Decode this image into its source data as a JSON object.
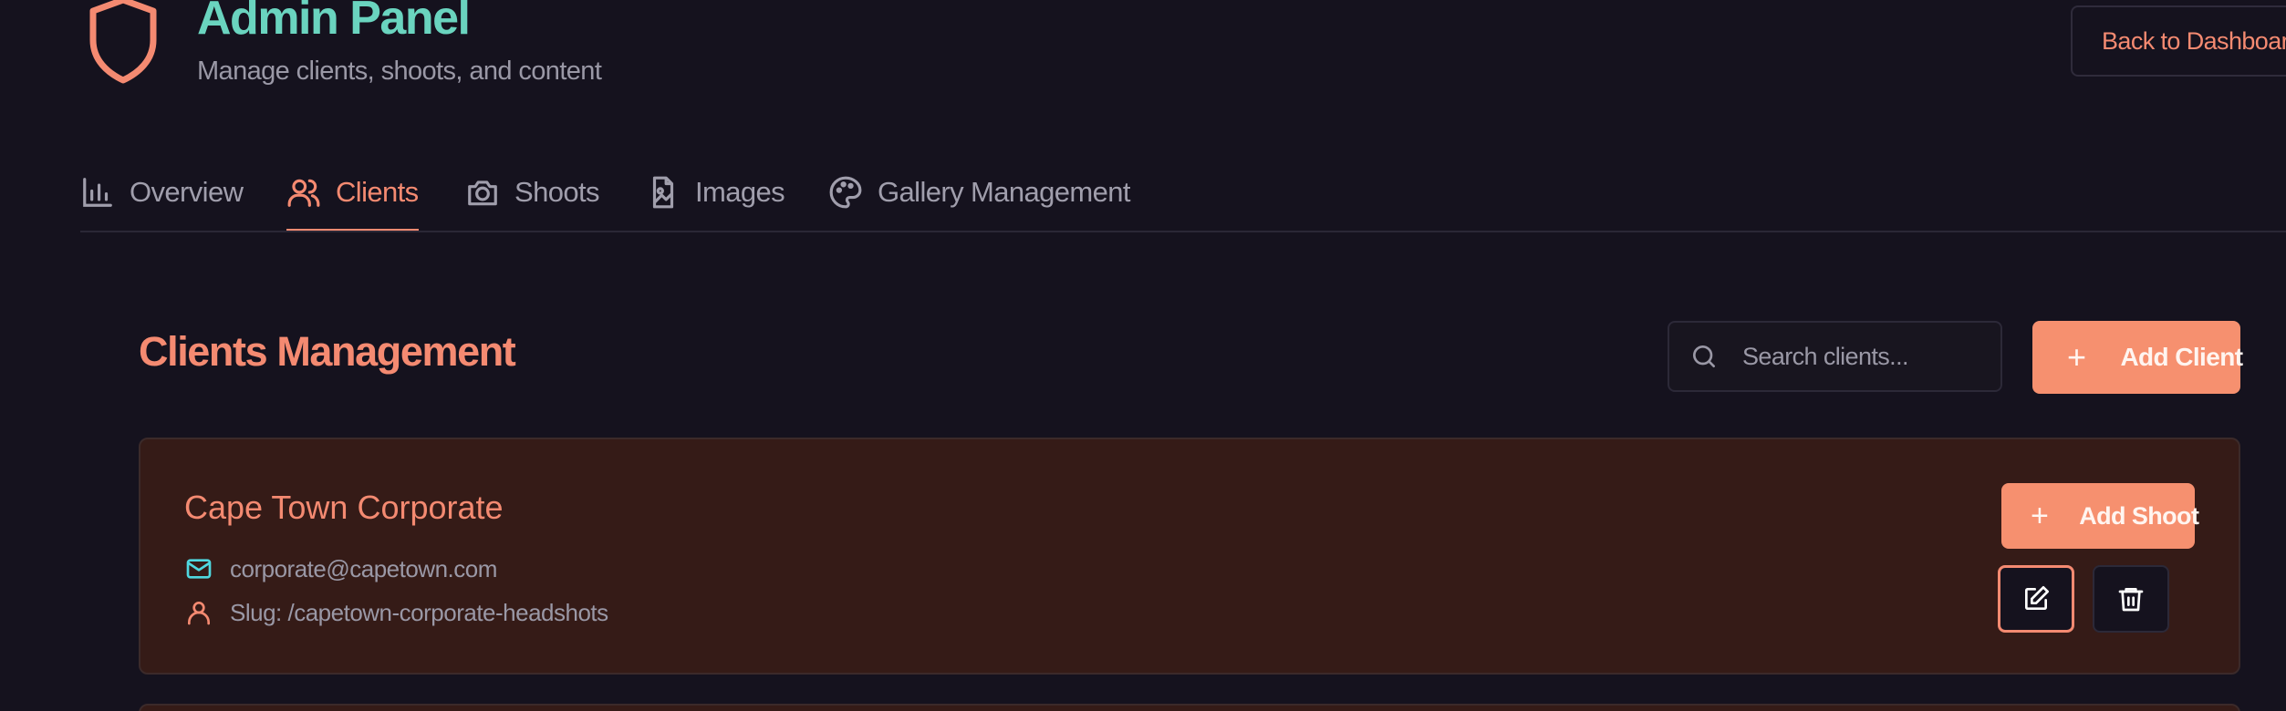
{
  "header": {
    "title": "Admin Panel",
    "subtitle": "Manage clients, shoots, and content",
    "back_button": "Back to Dashboard",
    "logo_icon": "shield-icon"
  },
  "tabs": [
    {
      "label": "Overview",
      "icon": "bar-chart-icon",
      "active": false
    },
    {
      "label": "Clients",
      "icon": "users-icon",
      "active": true
    },
    {
      "label": "Shoots",
      "icon": "camera-icon",
      "active": false
    },
    {
      "label": "Images",
      "icon": "image-file-icon",
      "active": false
    },
    {
      "label": "Gallery Management",
      "icon": "palette-icon",
      "active": false
    }
  ],
  "clients_section": {
    "title": "Clients Management",
    "search_placeholder": "Search clients...",
    "add_client_label": "Add Client"
  },
  "clients": [
    {
      "name": "Cape Town Corporate",
      "email": "corporate@capetown.com",
      "slug": "Slug: /capetown-corporate-headshots",
      "add_shoot_label": "Add Shoot"
    }
  ],
  "colors": {
    "background": "#15121e",
    "accent": "#f48a71",
    "title_teal": "#6ad4bf",
    "card_background": "#351b17",
    "email_icon": "#4fd8e0"
  }
}
